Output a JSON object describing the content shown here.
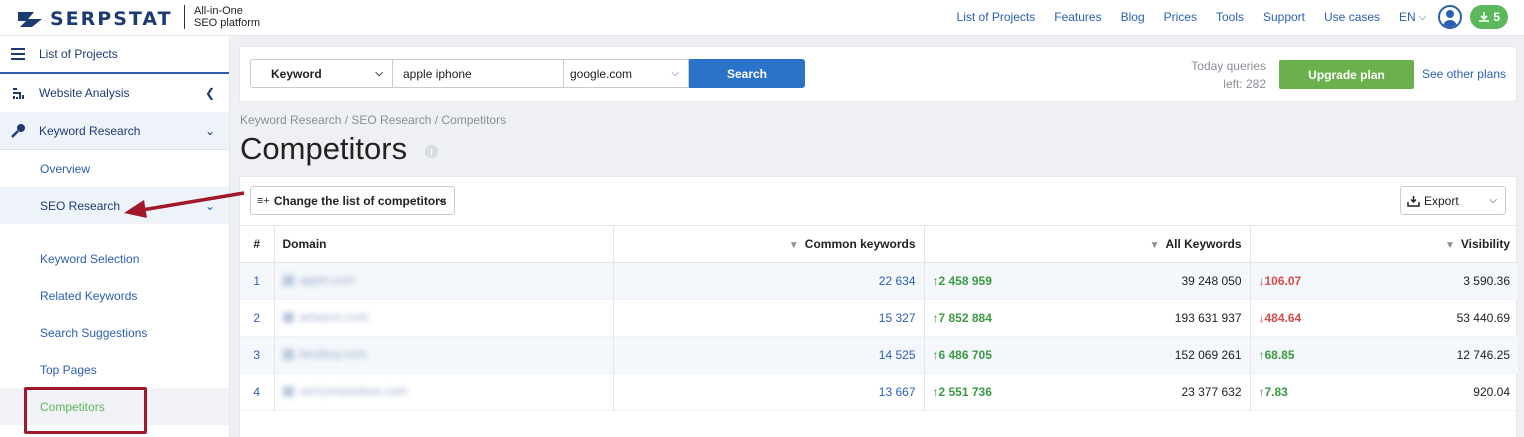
{
  "brand": {
    "name": "SERPSTAT",
    "tagline_line1": "All-in-One",
    "tagline_line2": "SEO platform",
    "color": "#1c3b73"
  },
  "topnav": {
    "links": [
      "List of Projects",
      "Features",
      "Blog",
      "Prices",
      "Tools",
      "Support",
      "Use cases"
    ],
    "language": "EN",
    "downloads_count": "5"
  },
  "sidebar": {
    "list_of_projects": "List of Projects",
    "website_analysis": "Website Analysis",
    "keyword_research": "Keyword Research",
    "items": [
      "Overview",
      "SEO Research",
      "Keyword Selection",
      "Related Keywords",
      "Search Suggestions",
      "Top Pages",
      "Competitors"
    ],
    "active_item": "Competitors"
  },
  "search": {
    "type": "Keyword",
    "query": "apple iphone",
    "database": "google.com",
    "button": "Search",
    "queries_line1": "Today queries",
    "queries_line2": "left: 282",
    "upgrade": "Upgrade plan",
    "other_plans": "See other plans"
  },
  "breadcrumb": "Keyword Research / SEO Research / Competitors",
  "page_title": "Competitors",
  "toolbar": {
    "change_list": "Change the list of competitors",
    "export": "Export"
  },
  "table": {
    "headers": {
      "num": "#",
      "domain": "Domain",
      "common": "Common keywords",
      "all": "All Keywords",
      "visibility": "Visibility"
    },
    "rows": [
      {
        "num": "1",
        "domain": "apple.com",
        "common": "22 634",
        "common_delta": "2 458 959",
        "all": "39 248 050",
        "vis_delta": "106.07",
        "vis_dir": "down",
        "visibility": "3 590.36"
      },
      {
        "num": "2",
        "domain": "amazon.com",
        "common": "15 327",
        "common_delta": "7 852 884",
        "all": "193 631 937",
        "vis_delta": "484.64",
        "vis_dir": "down",
        "visibility": "53 440.69"
      },
      {
        "num": "3",
        "domain": "bestbuy.com",
        "common": "14 525",
        "common_delta": "6 486 705",
        "all": "152 069 261",
        "vis_delta": "68.85",
        "vis_dir": "up",
        "visibility": "12 746.25"
      },
      {
        "num": "4",
        "domain": "verizonwireless.com",
        "common": "13 667",
        "common_delta": "2 551 736",
        "all": "23 377 632",
        "vis_delta": "7.83",
        "vis_dir": "up",
        "visibility": "920.04"
      }
    ]
  },
  "colors": {
    "accent": "#2a73c9",
    "upgrade": "#6ab04c",
    "up": "#3a9a43",
    "down": "#d54b4b",
    "annotation": "#a0182a"
  }
}
